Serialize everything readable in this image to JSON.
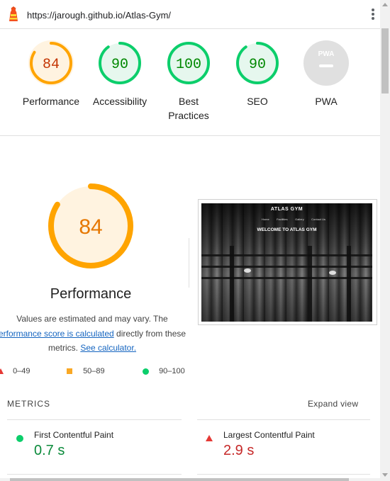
{
  "topbar": {
    "url": "https://jarough.github.io/Atlas-Gym/"
  },
  "summary_gauges": [
    {
      "label": "Performance",
      "score": "84",
      "category": "average"
    },
    {
      "label": "Accessibility",
      "score": "90",
      "category": "pass"
    },
    {
      "label": "Best Practices",
      "label_line1": "Best",
      "label_line2": "Practices",
      "score": "100",
      "category": "pass"
    },
    {
      "label": "SEO",
      "score": "90",
      "category": "pass"
    },
    {
      "label": "PWA",
      "badge": "PWA",
      "category": "na"
    }
  ],
  "performance": {
    "score": "84",
    "title": "Performance",
    "desc_line1": "Values are estimated and may vary. The",
    "desc_link1": "erformance score is calculated",
    "desc_line2_rest": " directly from these",
    "desc_line3_pre": "metrics. ",
    "desc_link2": "See calculator."
  },
  "legend": [
    {
      "range": "0–49",
      "shape": "triangle",
      "color": "#e53935"
    },
    {
      "range": "50–89",
      "shape": "square",
      "color": "#f9a825"
    },
    {
      "range": "90–100",
      "shape": "circle",
      "color": "#0cce6b"
    }
  ],
  "screenshot": {
    "site_title": "ATLAS GYM",
    "nav": [
      "Home",
      "Facilities",
      "Gallery",
      "Contact Us"
    ],
    "welcome": "WELCOME TO ATLAS GYM"
  },
  "metrics": {
    "heading": "METRICS",
    "expand_label": "Expand view",
    "items": [
      {
        "name": "First Contentful Paint",
        "value": "0.7 s",
        "status": "pass",
        "color": "#0a8a3a"
      },
      {
        "name": "Largest Contentful Paint",
        "value": "2.9 s",
        "status": "fail",
        "color": "#c62828"
      }
    ]
  },
  "colors": {
    "pass": "#0cce6b",
    "pass_text": "#008800",
    "pass_bg": "#e6f7ee",
    "average": "#ffa400",
    "average_text": "#c33300",
    "average_bg": "#fff3e0",
    "fail": "#ff4e42",
    "na_bg": "#e0e0e0"
  }
}
